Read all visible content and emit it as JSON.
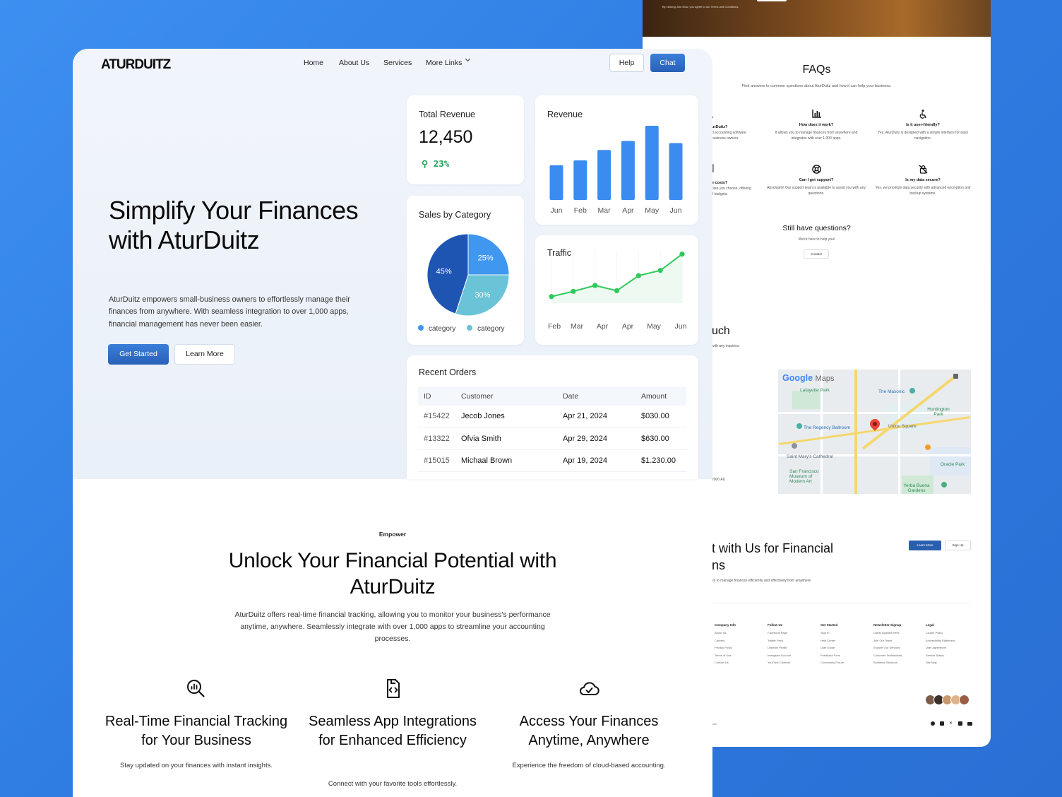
{
  "back_page": {
    "hero_legal": "By clicking Join Now, you agree to our Terms and Conditions.",
    "faq": {
      "title": "FAQs",
      "subtitle": "Find answers to common questions about AturDuitz and how it can help your business.",
      "partial_row1_q": "urDuitz?",
      "partial_row1_a1": "d accounting software",
      "partial_row1_a2": "business owners.",
      "partial_row2_q": "e costs?",
      "partial_row2_a1": "plan you choose, offering",
      "partial_row2_a2": "ll budgets.",
      "items": [
        {
          "icon": "bar-chart-icon",
          "question": "How does it work?",
          "answer": "It allows you to manage finances from anywhere and integrates with over 1,000 apps."
        },
        {
          "icon": "accessibility-icon",
          "question": "Is it user-friendly?",
          "answer": "Yes, AturDuitz is designed with a simple interface for easy navigation."
        },
        {
          "icon": "lifebuoy-icon",
          "question": "Can I get support?",
          "answer": "Absolutely! Our support team is available to assist you with any questions."
        },
        {
          "icon": "shield-lock-icon",
          "question": "Is my data secure?",
          "answer": "Yes, we prioritize data security with advanced encryption and backup systems."
        }
      ],
      "still_title": "Still have questions?",
      "still_sub": "We're here to help you!",
      "contact_label": "Contact"
    },
    "touch": {
      "title": "uch",
      "sub": "with any inquiries.",
      "address": "2000 AU"
    },
    "map": {
      "brand": "Google",
      "brand_suffix": "Maps",
      "labels": {
        "lafayette": "Lafayette Park",
        "masonic": "The Masonic",
        "huntington": "Huntington Park",
        "regency": "The Regency Ballroom",
        "union": "Union Square",
        "saint_mary": "Saint Mary's Cathedral",
        "oracle": "Oracle Park",
        "sfmoma": "San Francisco Museum of Modern Art",
        "yerba": "Yerba Buena Gardens"
      }
    },
    "cta": {
      "title_line1": "t with Us for Financial",
      "title_line2": "ns",
      "sub": "es to manage finances efficiently and effectively from anywhere",
      "learn_label": "Learn More",
      "signup_label": "Sign Up"
    },
    "footer": {
      "columns": [
        {
          "heading": "Company Info",
          "links": [
            "About Us",
            "Careers",
            "Privacy Policy",
            "Terms of Use",
            "Contact Us"
          ]
        },
        {
          "heading": "Follow Us",
          "links": [
            "Facebook Page",
            "Twitter Feed",
            "LinkedIn Profile",
            "Instagram Account",
            "YouTube Channel"
          ]
        },
        {
          "heading": "Get Started",
          "links": [
            "Sign In",
            "Help Center",
            "User Guide",
            "Feedback Form",
            "Community Forum"
          ]
        },
        {
          "heading": "Newsletter Signup",
          "links": [
            "Latest Updates Here",
            "Join Our Team",
            "Explore Our Services",
            "Customer Testimonials",
            "Business Solutions"
          ]
        },
        {
          "heading": "Legal",
          "links": [
            "Cookie Policy",
            "Accessibility Statement",
            "User Agreement",
            "Service Status",
            "Site Map"
          ]
        }
      ],
      "copyright": "ved.",
      "socials": [
        "facebook-icon",
        "instagram-icon",
        "x-icon",
        "linkedin-icon",
        "youtube-icon"
      ]
    }
  },
  "front_page": {
    "logo": "ATURDUITZ",
    "nav": {
      "home": "Home",
      "about": "About Us",
      "services": "Services",
      "more": "More Links"
    },
    "help_label": "Help",
    "chat_label": "Chat",
    "hero": {
      "title": "Simplify Your Finances with AturDuitz",
      "description": "AturDuitz empowers small-business owners to effortlessly manage their finances from anywhere. With seamless integration to over 1,000 apps, financial management has never been easier.",
      "get_started": "Get Started",
      "learn_more": "Learn More"
    },
    "total_revenue": {
      "title": "Total Revenue",
      "value": "12,450",
      "change": "23%"
    },
    "sales_by_category": {
      "title": "Sales by Category",
      "legend": [
        "category",
        "category"
      ]
    },
    "recent_orders": {
      "title": "Recent Orders",
      "columns": [
        "ID",
        "Customer",
        "Date",
        "Amount"
      ],
      "rows": [
        [
          "#15422",
          "Jecob Jones",
          "Apr  21, 2024",
          "$030.00"
        ],
        [
          "#13322",
          "Ofvia Smith",
          "Apr 29, 2024",
          "$630.00"
        ],
        [
          "#15015",
          "Michaal Brown",
          "Apr 19, 2024",
          "$1.230.00"
        ]
      ]
    },
    "empower": {
      "tag": "Empower",
      "title": "Unlock Your Financial Potential with AturDuitz",
      "description": "AturDuitz offers real-time financial tracking, allowing you to monitor your business's performance anytime, anywhere. Seamlessly integrate with over 1,000 apps to streamline your accounting processes."
    },
    "features": [
      {
        "icon": "chart-search-icon",
        "title": "Real-Time Financial Tracking for Your Business",
        "description": "Stay updated on your finances with instant insights."
      },
      {
        "icon": "code-file-icon",
        "title": "Seamless App Integrations for Enhanced Efficiency",
        "description": "Connect with your favorite tools effortlessly."
      },
      {
        "icon": "cloud-check-icon",
        "title": "Access Your Finances Anytime, Anywhere",
        "description": "Experience the freedom of cloud-based accounting."
      }
    ]
  },
  "chart_data": [
    {
      "type": "bar",
      "title": "Revenue",
      "categories": [
        "Jun",
        "Feb",
        "Mar",
        "Apr",
        "May",
        "Jun"
      ],
      "values": [
        50,
        57,
        72,
        85,
        107,
        82
      ],
      "ylim": [
        0,
        110
      ],
      "grid": false,
      "color": "#3b8bf0"
    },
    {
      "type": "pie",
      "title": "Sales by Category",
      "labels": [
        "25%",
        "30%",
        "45%"
      ],
      "values": [
        25,
        30,
        45
      ],
      "colors": [
        "#3f97f0",
        "#6ac3d6",
        "#1e55b3"
      ],
      "legend": [
        "category",
        "category"
      ],
      "legend_colors": [
        "#3f97f0",
        "#6ac3d6"
      ]
    },
    {
      "type": "line",
      "title": "Traffic",
      "categories": [
        "Feb",
        "Mar",
        "Apr",
        "Apr",
        "May",
        "Jun"
      ],
      "x_points": [
        0,
        1,
        2,
        3,
        4,
        5,
        6
      ],
      "values": [
        10,
        18,
        27,
        19,
        42,
        50,
        75
      ],
      "ylim": [
        0,
        80
      ],
      "grid": true,
      "color": "#2ec95c"
    }
  ]
}
